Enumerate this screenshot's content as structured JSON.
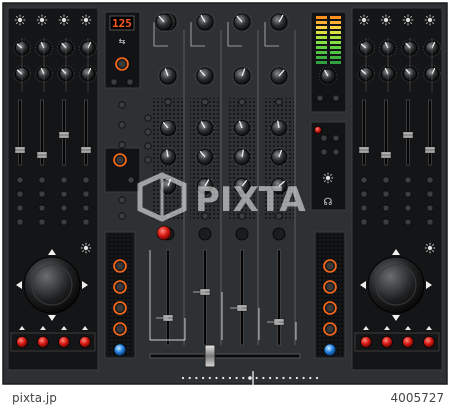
{
  "mixer": {
    "bpm_display": "125",
    "watermark": "PIXTA",
    "credit": "pixta.jp",
    "image_id": "4005727"
  }
}
